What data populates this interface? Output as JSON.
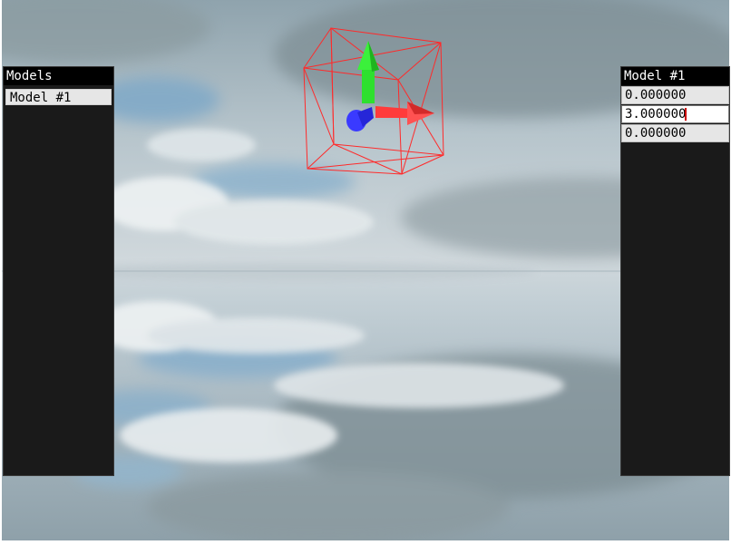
{
  "models_panel": {
    "title": "Models",
    "items": [
      {
        "label": "Model #1"
      }
    ]
  },
  "properties_panel": {
    "title": "Model #1",
    "fields": [
      {
        "value": "0.000000"
      },
      {
        "value": "3.000000"
      },
      {
        "value": "0.000000"
      }
    ]
  },
  "gizmo": {
    "icons": [
      "translate-gizmo-icon",
      "bounding-box-icon"
    ],
    "axis_colors": {
      "x": "#ff3b3b",
      "y": "#2ee02e",
      "z": "#3a3aff"
    },
    "box_color": "#ff2a2a"
  }
}
